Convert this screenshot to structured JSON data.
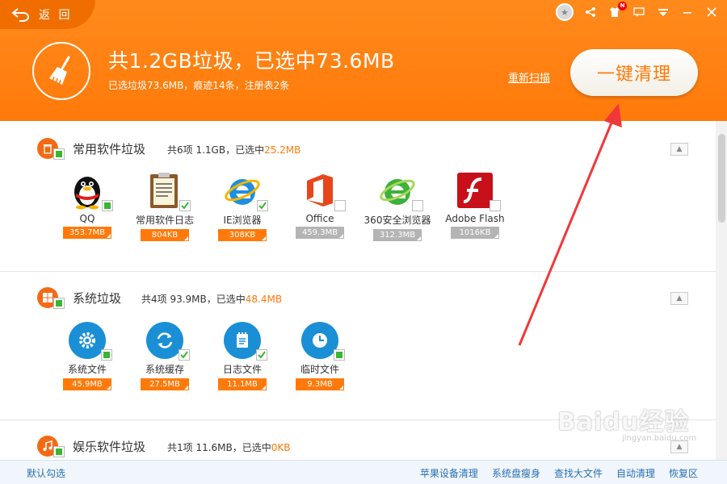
{
  "header": {
    "back_label": "返 回",
    "headline": "共1.2GB垃圾，已选中73.6MB",
    "subline": "已选垃圾73.6MB，痕迹14条，注册表2条",
    "rescan_label": "重新扫描",
    "clean_button_label": "一键清理",
    "topbar_badge": "N"
  },
  "sections": [
    {
      "title": "常用软件垃圾",
      "summary_prefix": "共6项 1.1GB，已选中",
      "summary_selected": "25.2MB",
      "items": [
        {
          "label": "QQ",
          "size": "353.7MB",
          "checked": true,
          "icon": "qq-penguin-icon"
        },
        {
          "label": "常用软件日志",
          "size": "804KB",
          "checked": true,
          "icon": "clipboard-log-icon"
        },
        {
          "label": "IE浏览器",
          "size": "308KB",
          "checked": true,
          "icon": "ie-browser-icon"
        },
        {
          "label": "Office",
          "size": "459.3MB",
          "checked": false,
          "icon": "office-icon"
        },
        {
          "label": "360安全浏览器",
          "size": "312.3MB",
          "checked": false,
          "icon": "360-browser-icon"
        },
        {
          "label": "Adobe Flash",
          "size": "1016KB",
          "checked": false,
          "icon": "flash-icon"
        }
      ]
    },
    {
      "title": "系统垃圾",
      "summary_prefix": "共4项 93.9MB，已选中",
      "summary_selected": "48.4MB",
      "items": [
        {
          "label": "系统文件",
          "size": "45.9MB",
          "checked": true,
          "icon": "gear-icon"
        },
        {
          "label": "系统缓存",
          "size": "27.5MB",
          "checked": true,
          "icon": "refresh-icon"
        },
        {
          "label": "日志文件",
          "size": "11.1MB",
          "checked": true,
          "icon": "notepad-icon"
        },
        {
          "label": "临时文件",
          "size": "9.3MB",
          "checked": true,
          "icon": "clock-icon"
        }
      ]
    },
    {
      "title": "娱乐软件垃圾",
      "summary_prefix": "共1项 11.6MB，已选中",
      "summary_selected": "0KB"
    }
  ],
  "footer": {
    "default_select": "默认勾选",
    "links": [
      "苹果设备清理",
      "系统盘瘦身",
      "查找大文件",
      "自动清理",
      "恢复区"
    ]
  },
  "watermark": {
    "main": "Baidu经验",
    "sub": "jingyan.baidu.com"
  },
  "colors": {
    "accent": "#ff7a0a",
    "checked": "#3bb436",
    "link": "#2a6fb5",
    "annotation_arrow": "#f0383a"
  }
}
